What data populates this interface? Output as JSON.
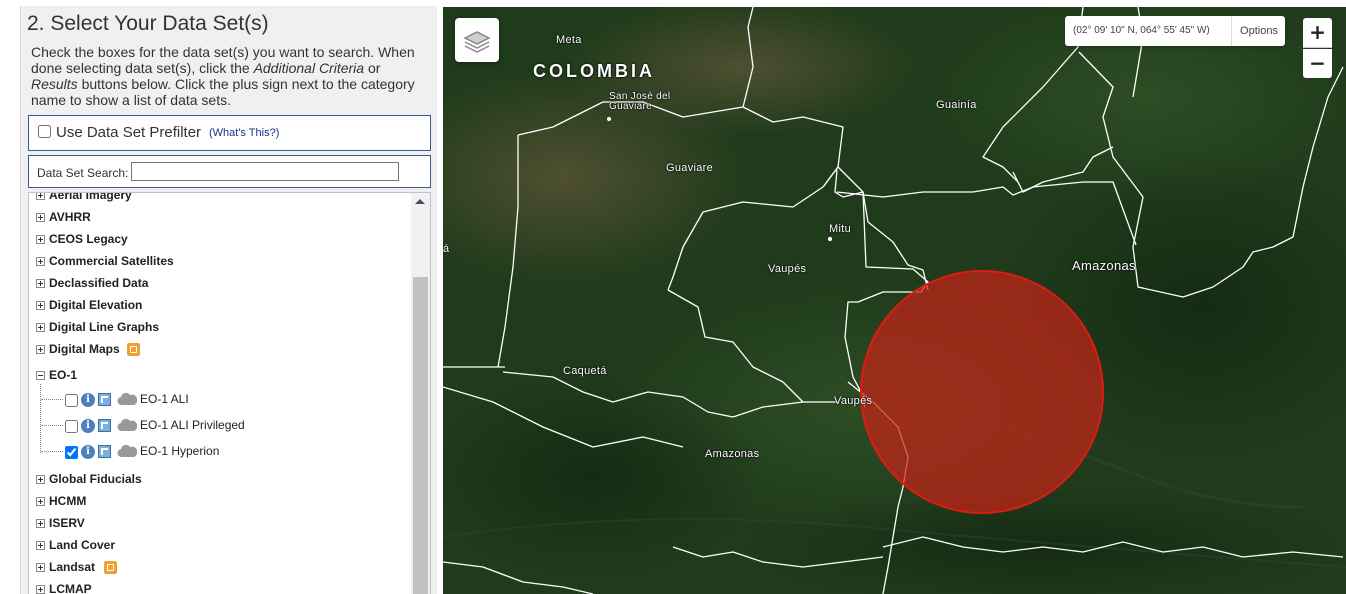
{
  "panel": {
    "title": "2. Select Your Data Set(s)",
    "instructions": {
      "part1": "Check the boxes for the data set(s) you want to search. When done selecting data set(s), click the ",
      "additional_criteria": "Additional Criteria",
      "or": " or ",
      "results": "Results",
      "part2": " buttons below. Click the plus sign next to the category name to show a list of data sets."
    },
    "prefilter": {
      "label": "Use Data Set Prefilter",
      "whats_this": "(What's This?)",
      "checked": false
    },
    "search": {
      "label": "Data Set Search:",
      "value": "",
      "placeholder": ""
    },
    "tree": {
      "categories_top": [
        {
          "label": "Aerial Imagery"
        },
        {
          "label": "AVHRR"
        },
        {
          "label": "CEOS Legacy"
        },
        {
          "label": "Commercial Satellites"
        },
        {
          "label": "Declassified Data"
        },
        {
          "label": "Digital Elevation"
        },
        {
          "label": "Digital Line Graphs"
        },
        {
          "label": "Digital Maps",
          "badge": "restricted-icon"
        }
      ],
      "expanded": {
        "label": "EO-1",
        "datasets": [
          {
            "label": "EO-1 ALI",
            "checked": false
          },
          {
            "label": "EO-1 ALI Privileged",
            "checked": false
          },
          {
            "label": "EO-1 Hyperion",
            "checked": true
          }
        ]
      },
      "categories_bottom": [
        {
          "label": "Global Fiducials"
        },
        {
          "label": "HCMM"
        },
        {
          "label": "ISERV"
        },
        {
          "label": "Land Cover"
        },
        {
          "label": "Landsat",
          "badge": "restricted-icon"
        },
        {
          "label": "LCMAP"
        }
      ]
    }
  },
  "map": {
    "coordinates": "(02° 09' 10\" N, 064° 55' 45\" W)",
    "options_label": "Options",
    "zoom_in_label": "+",
    "zoom_out_label": "−",
    "labels": {
      "country": "COLOMBIA",
      "meta": "Meta",
      "san_jose": "San José del Guaviare",
      "guainia": "Guainía",
      "guaviare": "Guaviare",
      "mitu": "Mitu",
      "vaupes_1": "Vaupés",
      "amazonas_east": "Amazonas",
      "caqueta": "Caquetá",
      "vaupes_2": "Vaupés",
      "amazonas_south": "Amazonas",
      "edge_letter": "á"
    },
    "colors": {
      "circle": "#c62318",
      "borders": "#ffffff",
      "terrain": "#1e3a1a"
    }
  }
}
